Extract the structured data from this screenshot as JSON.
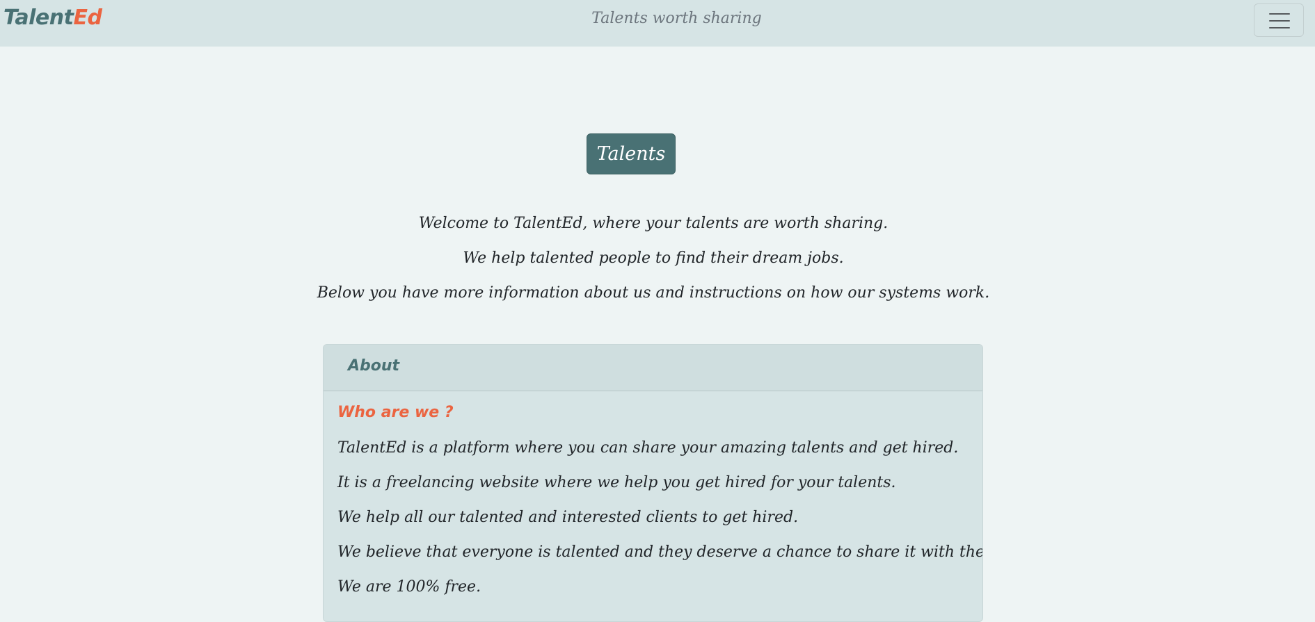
{
  "navbar": {
    "brand_main": "Talent",
    "brand_accent": "Ed",
    "tagline": "Talents worth sharing",
    "menu_icon": "hamburger-menu-icon"
  },
  "hero": {
    "button_label": "Talents",
    "intro_lines": [
      "Welcome to TalentEd, where your talents are worth sharing.",
      "We help talented people to find their dream jobs.",
      "Below you have more information about us and instructions on how our systems work."
    ]
  },
  "about_card": {
    "header": "About",
    "subtitle": "Who are we ?",
    "lines": [
      "TalentEd is a platform where you can share your amazing talents and get hired.",
      "It is a freelancing website where we help you get hired for your talents.",
      "We help all our talented and interested clients to get hired.",
      "We believe that everyone is talented and they deserve a chance to share it with the world.",
      "We are 100% free."
    ]
  },
  "colors": {
    "navbar_bg": "#d6e4e5",
    "page_bg": "#eef4f4",
    "primary": "#497174",
    "accent": "#eb6440"
  }
}
